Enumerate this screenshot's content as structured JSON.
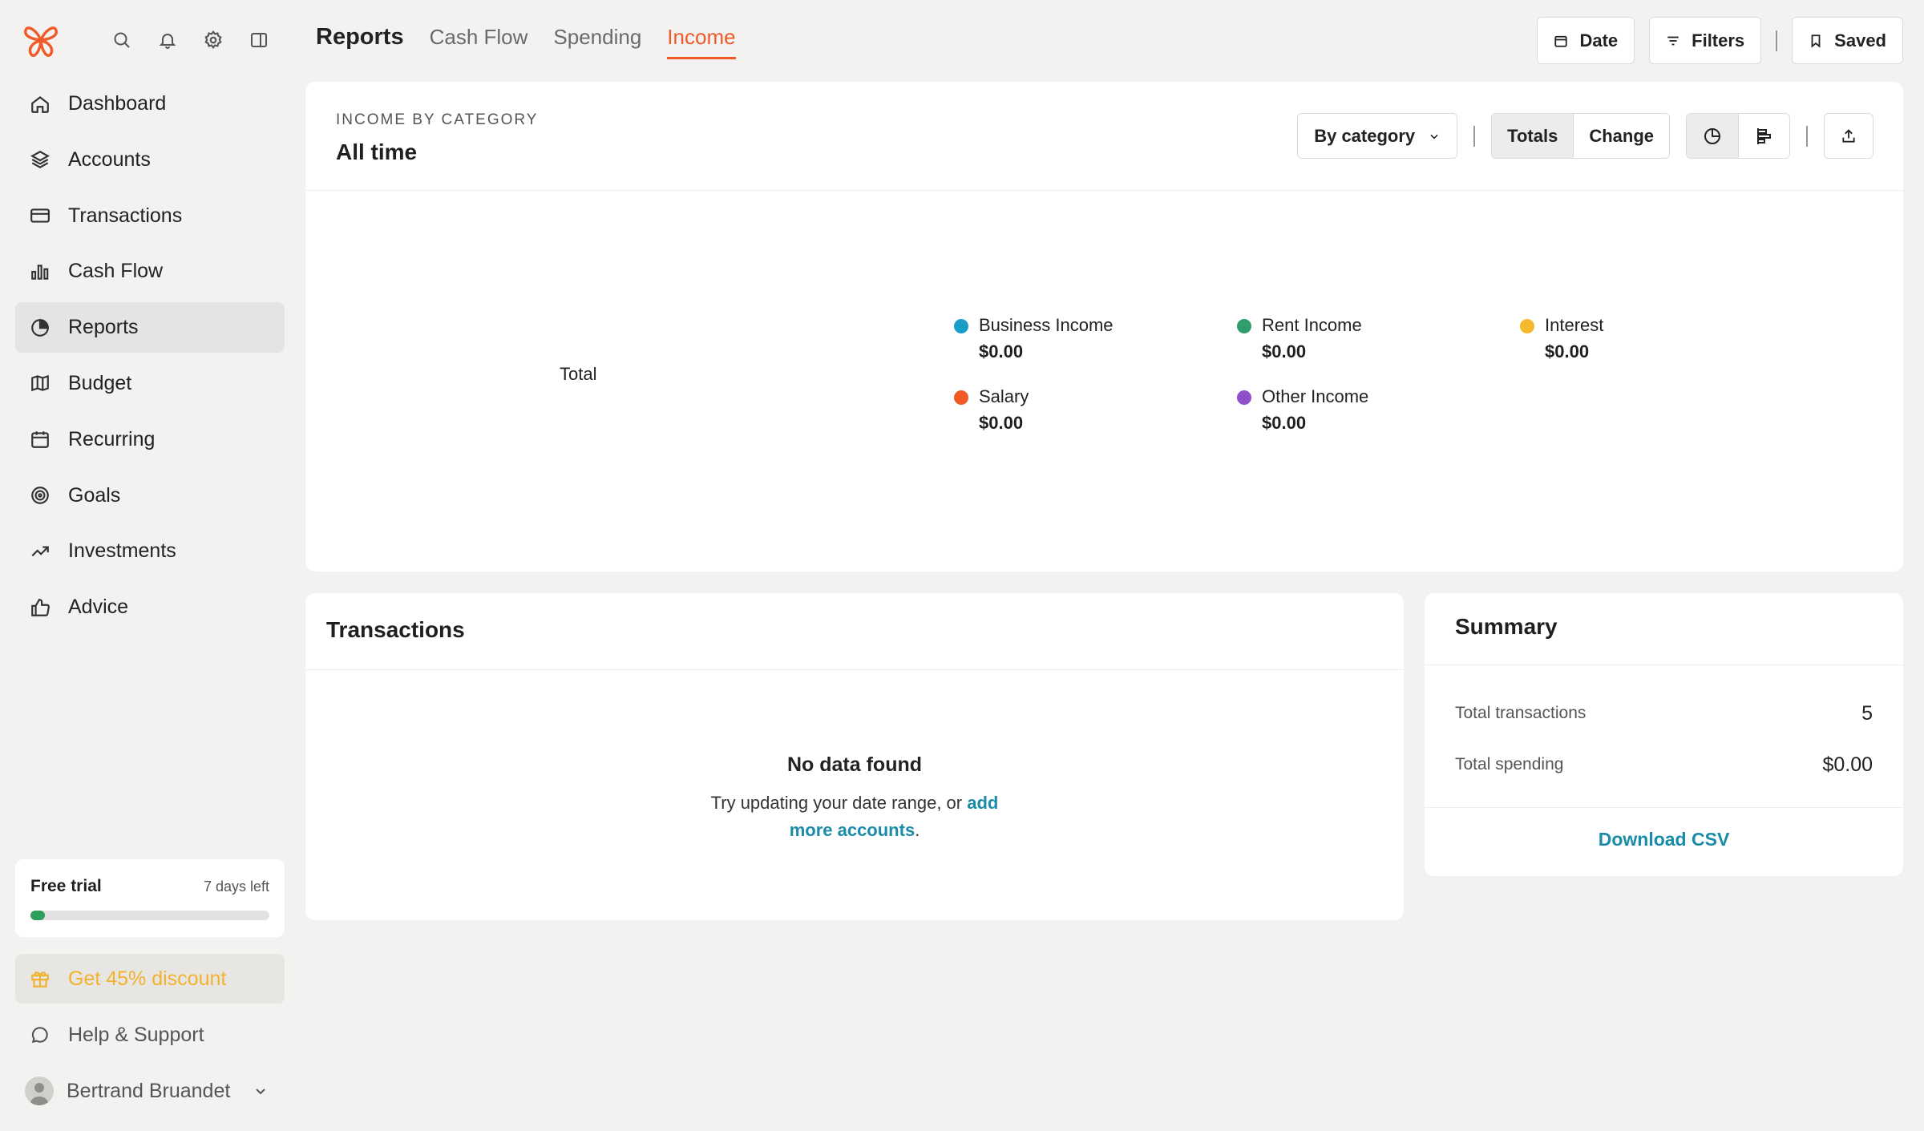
{
  "brand": {
    "accent": "#f05a28"
  },
  "sidebar": {
    "top_icons": [
      "search-icon",
      "bell-icon",
      "gear-icon",
      "panel-icon"
    ],
    "items": [
      {
        "label": "Dashboard",
        "icon": "home-icon"
      },
      {
        "label": "Accounts",
        "icon": "layers-icon"
      },
      {
        "label": "Transactions",
        "icon": "card-icon"
      },
      {
        "label": "Cash Flow",
        "icon": "bar-chart-icon"
      },
      {
        "label": "Reports",
        "icon": "pie-chart-icon",
        "active": true
      },
      {
        "label": "Budget",
        "icon": "map-icon"
      },
      {
        "label": "Recurring",
        "icon": "calendar-icon"
      },
      {
        "label": "Goals",
        "icon": "target-icon"
      },
      {
        "label": "Investments",
        "icon": "trending-up-icon"
      },
      {
        "label": "Advice",
        "icon": "thumbs-up-icon"
      }
    ],
    "trial": {
      "title": "Free trial",
      "days_left": "7 days left",
      "progress": 0.03
    },
    "discount": "Get 45% discount",
    "help": "Help & Support",
    "user": "Bertrand Bruandet"
  },
  "header": {
    "title": "Reports",
    "tabs": [
      "Cash Flow",
      "Spending",
      "Income"
    ],
    "active_tab": "Income",
    "actions": {
      "date": "Date",
      "filters": "Filters",
      "saved": "Saved"
    }
  },
  "income_card": {
    "kicker": "INCOME BY CATEGORY",
    "title": "All time",
    "dropdown": "By category",
    "seg_totals": "Totals",
    "seg_change": "Change",
    "total_label": "Total"
  },
  "chart_data": {
    "type": "pie",
    "title": "INCOME BY CATEGORY",
    "subtitle": "All time",
    "categories": [
      "Business Income",
      "Rent Income",
      "Interest",
      "Salary",
      "Other Income"
    ],
    "values": [
      0,
      0,
      0,
      0,
      0
    ],
    "value_labels": [
      "$0.00",
      "$0.00",
      "$0.00",
      "$0.00",
      "$0.00"
    ],
    "colors": [
      "#1a9ec9",
      "#2e9e6b",
      "#f5b92e",
      "#f05a28",
      "#8e4fc9"
    ],
    "legend": "right"
  },
  "transactions": {
    "title": "Transactions",
    "empty_title": "No data found",
    "empty_msg": "Try updating your date range, or ",
    "empty_link": "add more accounts",
    "empty_end": "."
  },
  "summary": {
    "title": "Summary",
    "rows": [
      {
        "label": "Total transactions",
        "value": "5"
      },
      {
        "label": "Total spending",
        "value": "$0.00"
      }
    ],
    "download": "Download CSV"
  }
}
